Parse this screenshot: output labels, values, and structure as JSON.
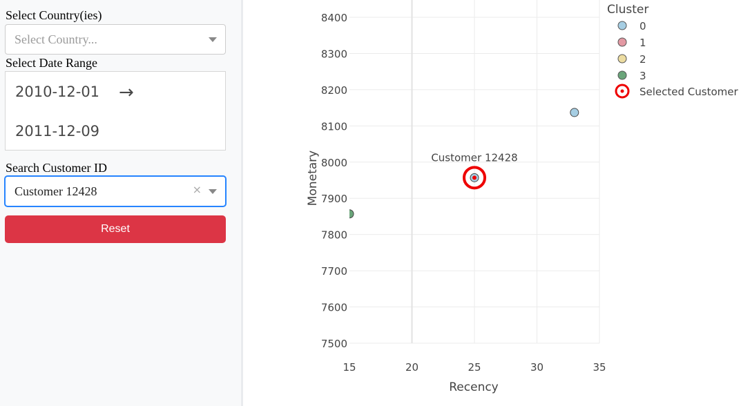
{
  "sidebar": {
    "country_label": "Select Country(ies)",
    "country_placeholder": "Select Country...",
    "date_label": "Select Date Range",
    "date_start": "2010-12-01",
    "date_end": "2011-12-09",
    "date_arrow": "→",
    "customer_label": "Search Customer ID",
    "customer_value": "Customer 12428",
    "clear_glyph": "×",
    "reset_label": "Reset"
  },
  "icons": {
    "country_caret": "chevron-down-icon",
    "customer_caret": "chevron-down-icon",
    "customer_clear": "close-icon",
    "date_arrow": "arrow-right-icon"
  },
  "colors": {
    "reset_button": "#dc3545",
    "focus_border": "#2684ff",
    "cluster_0": "#a6cee3",
    "cluster_1": "#e399a3",
    "cluster_2": "#ecdca1",
    "cluster_3": "#6aa57a",
    "selected_marker": "#ee0000"
  },
  "chart_data": {
    "type": "scatter",
    "xlabel": "Recency",
    "ylabel": "Monetary",
    "xlim": [
      15,
      35
    ],
    "ylim": [
      7475,
      8425
    ],
    "xticks": [
      15,
      20,
      25,
      30,
      35
    ],
    "yticks": [
      7500,
      7600,
      7700,
      7800,
      7900,
      8000,
      8100,
      8200,
      8300,
      8400
    ],
    "grid": true,
    "legend_title": "Cluster",
    "legend_placement": "top-right",
    "series": [
      {
        "name": "0",
        "color": "#a6cee3",
        "points": [
          {
            "x": 33,
            "y": 8137
          },
          {
            "x": 25,
            "y": 7957
          }
        ]
      },
      {
        "name": "1",
        "color": "#e399a3",
        "points": []
      },
      {
        "name": "2",
        "color": "#ecdca1",
        "points": []
      },
      {
        "name": "3",
        "color": "#6aa57a",
        "points": [
          {
            "x": 15,
            "y": 7857
          }
        ]
      }
    ],
    "selected": {
      "name": "Selected Customer",
      "label": "Customer 12428",
      "x": 25,
      "y": 7957
    }
  }
}
